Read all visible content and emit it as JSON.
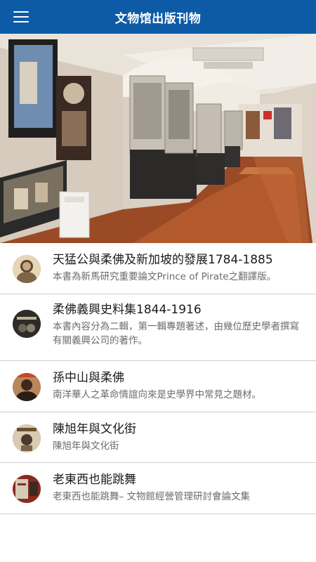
{
  "header": {
    "title": "文物馆出版刊物",
    "menu_icon": "hamburger-menu-icon"
  },
  "hero": {
    "image": "museum-gallery-photo"
  },
  "colors": {
    "appbar": "#0d5ba6",
    "title_text": "#1a1a1a",
    "desc_text": "#6b6b6b",
    "divider": "#cfcfcf"
  },
  "publications": [
    {
      "title": "天猛公與柔佛及新加坡的發展1784-1885",
      "desc": "本書為新馬研究重要論文Prince of Pirate之翻譯版。",
      "thumb": "portrait-cover"
    },
    {
      "title": "柔佛義興史料集1844-1916",
      "desc": "本書內容分為二輯，第一輯專題著述，由幾位歷史學者撰寫有關義興公司的著作。",
      "thumb": "dark-book-cover"
    },
    {
      "title": "孫中山與柔佛",
      "desc": "南洋華人之革命情誼向來是史學界中常見之題材。",
      "thumb": "portrait-cover"
    },
    {
      "title": "陳旭年與文化街",
      "desc": "陳旭年與文化街",
      "thumb": "book-cover"
    },
    {
      "title": "老東西也能跳舞",
      "desc": "老東西也能跳舞– 文物館經營管理研討會論文集",
      "thumb": "red-book-cover"
    }
  ]
}
